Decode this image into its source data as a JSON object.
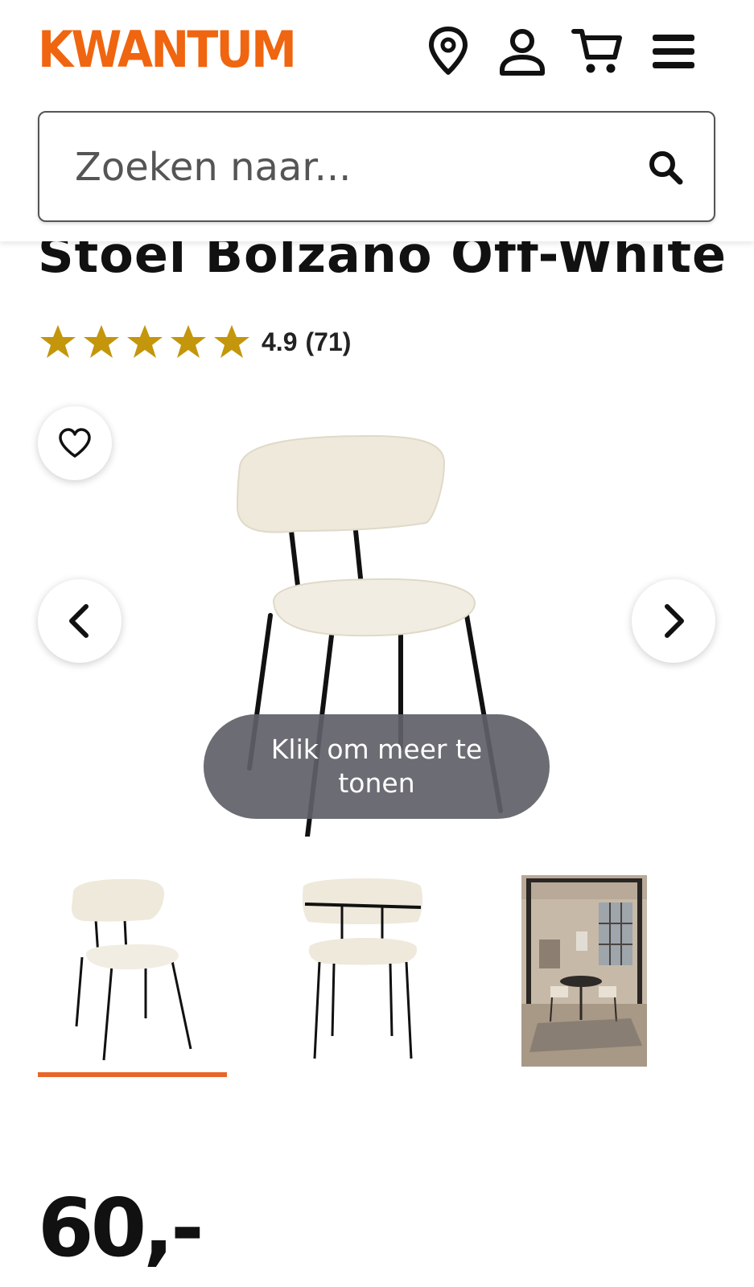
{
  "header": {
    "logo": "KWANTUM",
    "icons": [
      "location-icon",
      "account-icon",
      "cart-icon",
      "menu-icon"
    ],
    "brand_color": "#f0650f"
  },
  "search": {
    "placeholder": "Zoeken naar..."
  },
  "product": {
    "title": "Stoel Bolzano Off-White",
    "rating": {
      "stars": 5,
      "score": "4.9",
      "count": "(71)",
      "star_color": "#c4960c"
    },
    "gallery": {
      "more_label": "Klik om meer te tonen",
      "active_thumbnail": 1,
      "thumbnails": [
        "chair-front",
        "chair-back",
        "chair-room"
      ]
    },
    "price": "60,-"
  }
}
